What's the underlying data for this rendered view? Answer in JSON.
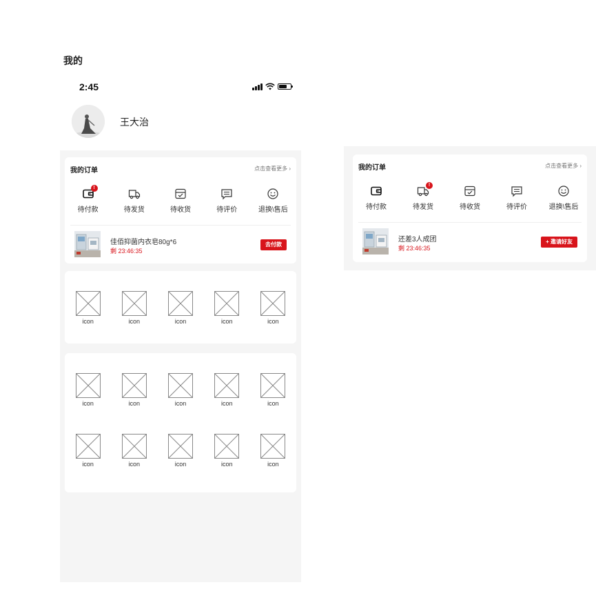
{
  "page": {
    "title": "我的"
  },
  "status_bar": {
    "time": "2:45"
  },
  "user": {
    "name": "王大治"
  },
  "orders": {
    "title": "我的订单",
    "more": "点击查看更多 ›",
    "statuses": [
      {
        "label": "待付款",
        "icon": "wallet-icon"
      },
      {
        "label": "待发货",
        "icon": "truck-icon"
      },
      {
        "label": "待收货",
        "icon": "inbox-icon"
      },
      {
        "label": "待评价",
        "icon": "message-icon"
      },
      {
        "label": "退换\\售后",
        "icon": "smile-icon"
      }
    ],
    "badge": "!"
  },
  "pending_order": {
    "product": "佳佰抑菌内衣皂80g*6",
    "timer": "剩 23:46:35",
    "button": "去付款"
  },
  "group_order": {
    "product": "还差3人成团",
    "timer": "剩 23:46:35",
    "button": "+ 邀请好友"
  },
  "icon_grid_1": [
    "icon",
    "icon",
    "icon",
    "icon",
    "icon"
  ],
  "icon_grid_2": [
    [
      "icon",
      "icon",
      "icon",
      "icon",
      "icon"
    ],
    [
      "icon",
      "icon",
      "icon",
      "icon",
      "icon"
    ]
  ],
  "colors": {
    "accent": "#d8141b",
    "page_bg": "#f5f5f5",
    "card_bg": "#ffffff"
  }
}
